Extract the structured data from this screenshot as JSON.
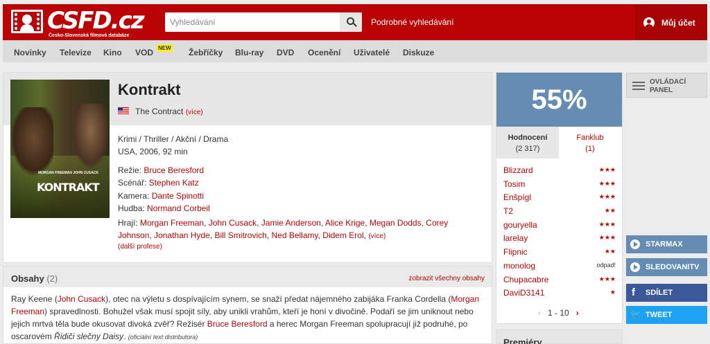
{
  "header": {
    "logo_text": "CSFD.cz",
    "logo_sub": "Česko-Slovenská filmová databáze",
    "search_placeholder": "Vyhledávání",
    "advanced_search": "Podrobné vyhledávání",
    "account": "Můj účet"
  },
  "nav": {
    "items": [
      "Novinky",
      "Televize",
      "Kino",
      "VOD",
      "Žebříčky",
      "Blu-ray",
      "DVD",
      "Ocenění",
      "Uživatelé",
      "Diskuze"
    ],
    "badge": "NEW"
  },
  "film": {
    "title": "Kontrakt",
    "original_title": "The Contract",
    "more": "(více)",
    "genres": "Krimi / Thriller / Akční / Drama",
    "origin": "USA, 2006, 92 min",
    "poster_names": "MORGAN FREEMAN    JOHN CUSACK",
    "poster_title": "KONTRAKT",
    "credits": [
      {
        "label": "Režie:",
        "value": "Bruce Beresford"
      },
      {
        "label": "Scénář:",
        "value": "Stephen Katz"
      },
      {
        "label": "Kamera:",
        "value": "Dante Spinotti"
      },
      {
        "label": "Hudba:",
        "value": "Normand Corbeil"
      }
    ],
    "actors_label": "Hrají:",
    "actors": [
      "Morgan Freeman",
      "John Cusack",
      "Jamie Anderson",
      "Alice Krige",
      "Megan Dodds",
      "Corey Johnson",
      "Jonathan Hyde",
      "Bill Smitrovich",
      "Ned Bellamy",
      "Didem Erol"
    ],
    "actors_more": "(více)",
    "more_professions": "(další profese)"
  },
  "plot": {
    "title": "Obsahy",
    "count": "(2)",
    "show_all": "zobrazit všechny obsahy",
    "p1": "Ray Keene (",
    "link1": "John Cusack",
    "p2": "), otec na výletu s dospívajícím synem, se snaží předat nájemného zabijáka Franka Cordella (",
    "link2": "Morgan Freeman",
    "p3": ") spravedlnosti. Bohužel však musí spojit síly, aby unikli vrahům, kteří je honí v divočině. Podaří se jim uniknout nebo jejich mrtvá těla bude okusovat divoká zvěř? Režisér ",
    "link3": "Bruce Beresford",
    "p4": " a herec Morgan Freeman spolupracují již podruhé, po oscarovém ",
    "italic": "Řidiči slečny Daisy",
    "p5": ".",
    "dist": "(oficiální text distributora)"
  },
  "rating": {
    "score": "55%",
    "tab1_label": "Hodnocení",
    "tab1_count": "(2 317)",
    "tab2_label": "Fanklub",
    "tab2_count": "(1)",
    "users": [
      {
        "name": "Blizzard",
        "stars": "★★★"
      },
      {
        "name": "Tosim",
        "stars": "★★★"
      },
      {
        "name": "Enšpígl",
        "stars": "★★★"
      },
      {
        "name": "T2",
        "stars": "★★"
      },
      {
        "name": "gouryella",
        "stars": "★★★"
      },
      {
        "name": "larelay",
        "stars": "★★★"
      },
      {
        "name": "Flipnic",
        "stars": "★★"
      },
      {
        "name": "monolog",
        "odpad": "odpad!"
      },
      {
        "name": "Chupacabre",
        "stars": "★★★"
      },
      {
        "name": "DaviD3141",
        "stars": "★"
      }
    ],
    "pager": "1 - 10",
    "prev": "‹",
    "next": "›"
  },
  "premiery": "Premiéry",
  "sidebar": {
    "control_line1": "OVLÁDACÍ",
    "control_line2": "PANEL",
    "starmax": "STARMAX",
    "sledovani": "SLEDOVANITV",
    "share": "SDÍLET",
    "tweet": "TWEET",
    "fb_glyph": "f",
    "tw_glyph": "🐦"
  }
}
